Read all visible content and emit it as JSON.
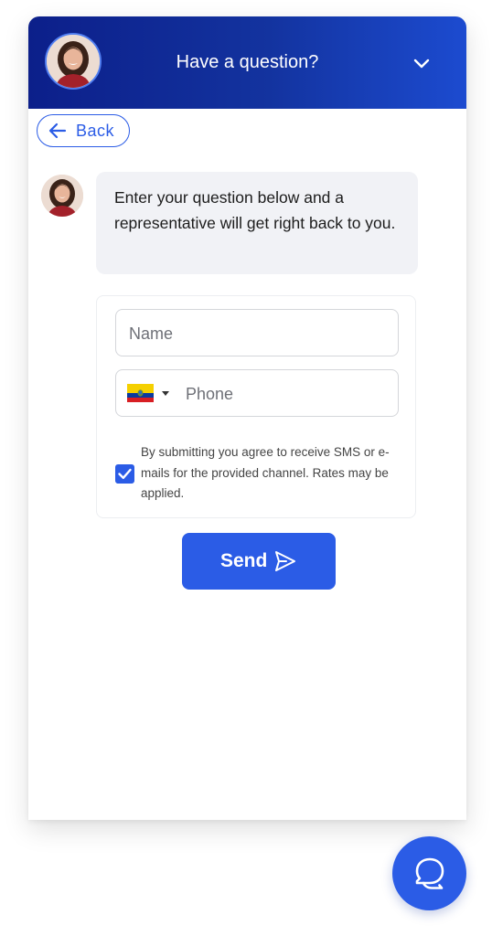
{
  "header": {
    "title": "Have a question?",
    "toggle_icon": "chevron-down-icon",
    "avatar": "agent-avatar"
  },
  "back_button": {
    "label": "Back",
    "icon": "arrow-left-icon"
  },
  "message": {
    "text": "Enter your question below and a representative will get right back to you.",
    "avatar": "agent-avatar"
  },
  "form": {
    "name_placeholder": "Name",
    "phone_placeholder": "Phone",
    "country_flag": "ecuador-flag",
    "consent_checked": true,
    "consent_text": "By submitting you agree to receive SMS or e-mails for the provided channel. Rates may be applied."
  },
  "send_button": {
    "label": "Send",
    "icon": "send-icon"
  },
  "launcher": {
    "icon": "chat-bubble-icon"
  },
  "colors": {
    "header_gradient_start": "#0c1f8a",
    "header_gradient_end": "#1c4bd0",
    "accent": "#2b5ce6",
    "bubble_bg": "#f1f2f6"
  }
}
